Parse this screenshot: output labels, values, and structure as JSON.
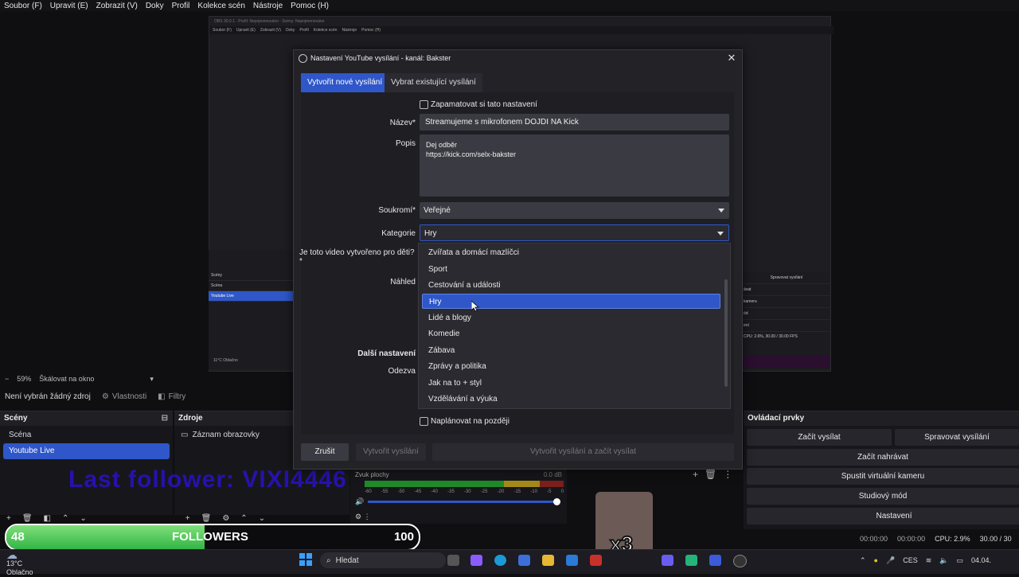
{
  "menu": [
    "Soubor (F)",
    "Upravit (E)",
    "Zobrazit (V)",
    "Doky",
    "Profil",
    "Kolekce scén",
    "Nástroje",
    "Pomoc (H)"
  ],
  "zoom": {
    "percent": "59%",
    "mode": "Škálovat na okno"
  },
  "source_status": {
    "none_selected": "Není vybrán žádný zdroj",
    "properties": "Vlastnosti",
    "filters": "Filtry"
  },
  "scenes": {
    "title": "Scény",
    "items": [
      "Scéna",
      "Youtube Live"
    ],
    "selected_index": 1
  },
  "sources": {
    "title": "Zdroje",
    "items": [
      "Záznam obrazovky"
    ]
  },
  "controls": {
    "title": "Ovládací prvky",
    "start_stream": "Začít vysílat",
    "manage_stream": "Spravovat vysílání",
    "start_recording": "Začít nahrávat",
    "virtual_camera": "Spustit virtuální kameru",
    "studio_mode": "Studiový mód",
    "settings": "Nastavení"
  },
  "mixer": {
    "channel": "Zvuk plochy",
    "db": "0.0 dB",
    "ticks": [
      "-60",
      "-55",
      "-50",
      "-45",
      "-40",
      "-35",
      "-30",
      "-25",
      "-20",
      "-15",
      "-10",
      "-5",
      "0"
    ]
  },
  "statusbar": {
    "rec_time": "00:00:00",
    "stream_time": "00:00:00",
    "cpu": "CPU: 2.9%",
    "fps": "30.00 / 30"
  },
  "overlay": {
    "last_follower": "Last follower: VIXI4446",
    "followers_current": "48",
    "followers_label": "FOLLOWERS",
    "followers_goal": "100",
    "followers_progress": 0.48,
    "meme_multiplier": "x3"
  },
  "taskbar": {
    "temp": "13°C",
    "condition": "Oblačno",
    "search": "Hledat",
    "lang": "CES",
    "date": "04.04."
  },
  "dialog": {
    "title": "Nastavení YouTube vysílání - kanál: Bakster",
    "tab_new": "Vytvořit nové vysílání",
    "tab_existing": "Vybrat existující vysílání",
    "remember": "Zapamatovat si tato nastavení",
    "name_label": "Název*",
    "name_value": "Streamujeme s mikrofonem DOJDI NA Kick",
    "desc_label": "Popis",
    "desc_line1": "Dej odběr",
    "desc_line2": "https://kick.com/selx-bakster",
    "privacy_label": "Soukromí*",
    "privacy_value": "Veřejné",
    "category_label": "Kategorie",
    "category_value": "Hry",
    "kids_label": "Je toto video vytvořeno pro děti?*",
    "preview_label": "Náhled",
    "more_label": "Další nastavení",
    "latency_label": "Odezva",
    "schedule": "Naplánovat na později",
    "cancel": "Zrušit",
    "create": "Vytvořit vysílání",
    "create_start": "Vytvořit vysílání a začít vysílat",
    "categories": [
      "Zvířata a domácí mazlíčci",
      "Sport",
      "Cestování a události",
      "Hry",
      "Lidé a blogy",
      "Komedie",
      "Zábava",
      "Zprávy a politika",
      "Jak na to + styl",
      "Vzdělávání a výuka"
    ],
    "selected_category_index": 3
  },
  "preview": {
    "title": "OBS 30.0.1 - Profil: Nepojmenováno - Scény: Nepojmenováno",
    "menu": [
      "Soubor (F)",
      "Upravit (E)",
      "Zobrazit (V)",
      "Doky",
      "Profil",
      "Kolekce scén",
      "Nástroje",
      "Pomoc (H)"
    ],
    "scenes": [
      "Scény",
      "Scéna",
      "Youtube Live"
    ],
    "right_rows": [
      "Spravovat vysílání",
      "ávat",
      "kameru",
      "ód",
      "ení"
    ],
    "cpu": "CPU: 2.6%, 30.00 / 30.00 FPS",
    "weather": "11°C Oblačno"
  },
  "colors": {
    "accent": "#2f57c9",
    "follower_bar": "#33b545",
    "last_follower_text": "#2a10c8"
  }
}
